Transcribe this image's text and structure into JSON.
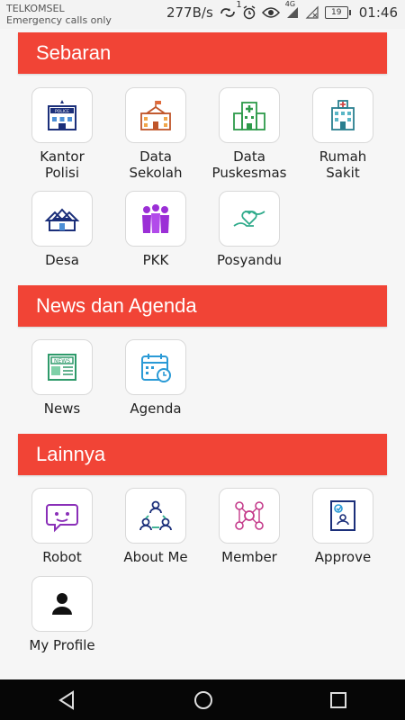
{
  "status_bar": {
    "carrier": "TELKOMSEL",
    "carrier_sub": "Emergency calls only",
    "speed": "277B/s",
    "sync_badge": "1",
    "network": "4G",
    "battery": "19",
    "time": "01:46"
  },
  "sections": {
    "sebaran": {
      "title": "Sebaran",
      "items": [
        {
          "label_line1": "Kantor",
          "label_line2": "Polisi",
          "icon": "police-station-icon"
        },
        {
          "label_line1": "Data",
          "label_line2": "Sekolah",
          "icon": "school-icon"
        },
        {
          "label_line1": "Data",
          "label_line2": "Puskesmas",
          "icon": "health-center-icon"
        },
        {
          "label_line1": "Rumah",
          "label_line2": "Sakit",
          "icon": "hospital-icon"
        },
        {
          "label_line1": "Desa",
          "label_line2": "",
          "icon": "village-icon"
        },
        {
          "label_line1": "PKK",
          "label_line2": "",
          "icon": "group-women-icon"
        },
        {
          "label_line1": "Posyandu",
          "label_line2": "",
          "icon": "heart-hands-icon"
        }
      ]
    },
    "news": {
      "title": "News dan Agenda",
      "items": [
        {
          "label_line1": "News",
          "icon": "newspaper-icon"
        },
        {
          "label_line1": "Agenda",
          "icon": "calendar-icon"
        }
      ]
    },
    "lainnya": {
      "title": "Lainnya",
      "items": [
        {
          "label_line1": "Robot",
          "icon": "robot-chat-icon"
        },
        {
          "label_line1": "About Me",
          "icon": "team-icon"
        },
        {
          "label_line1": "Member",
          "icon": "network-members-icon"
        },
        {
          "label_line1": "Approve",
          "icon": "approve-document-icon"
        },
        {
          "label_line1": "My Profile",
          "icon": "user-icon"
        }
      ]
    }
  },
  "colors": {
    "header_red": "#f14436",
    "background": "#f6f6f6",
    "navbar": "#060606"
  },
  "navbar": {
    "back": "back-triangle-icon",
    "home": "home-circle-icon",
    "recents": "recents-square-icon"
  }
}
